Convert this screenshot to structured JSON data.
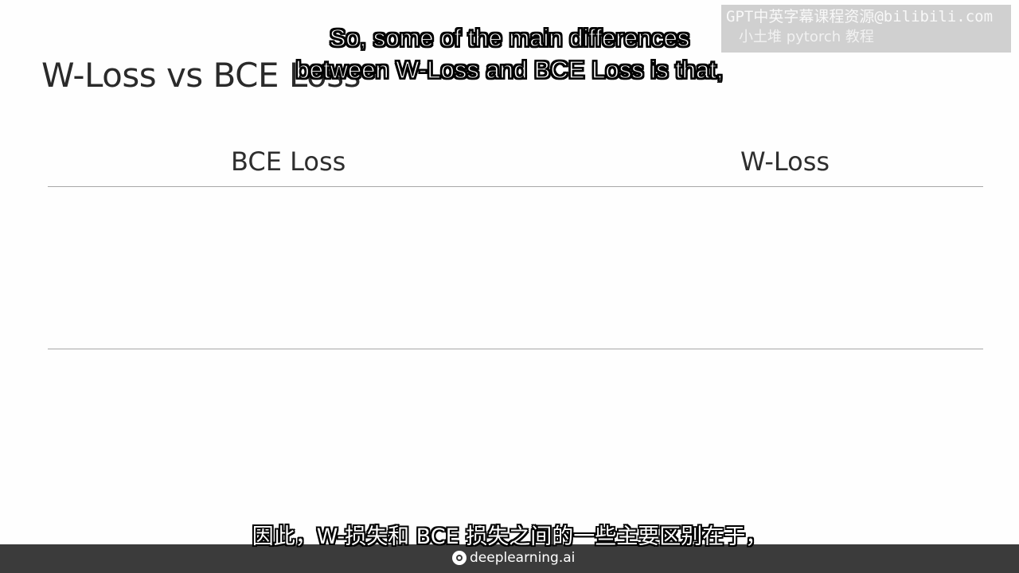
{
  "slide": {
    "title": "W-Loss vs BCE Loss",
    "columns": {
      "left_header": "BCE Loss",
      "right_header": "W-Loss"
    }
  },
  "subtitles": {
    "english_line1": "So, some of the main differences",
    "english_line2": "between W-Loss and BCE Loss is that,",
    "chinese": "因此，W-损失和 BCE 损失之间的一些主要区别在于，"
  },
  "watermark": {
    "line1": "GPT中英字幕课程资源@bilibili.com",
    "line2": "小土堆 pytorch 教程"
  },
  "footer": {
    "logo_icon": "deeplearning-logo-icon",
    "brand": "deeplearning.ai"
  },
  "colors": {
    "background": "#fefefe",
    "text": "#2a2a2a",
    "rule": "#a8a8a8",
    "footer_bar": "#3b3b3b"
  }
}
